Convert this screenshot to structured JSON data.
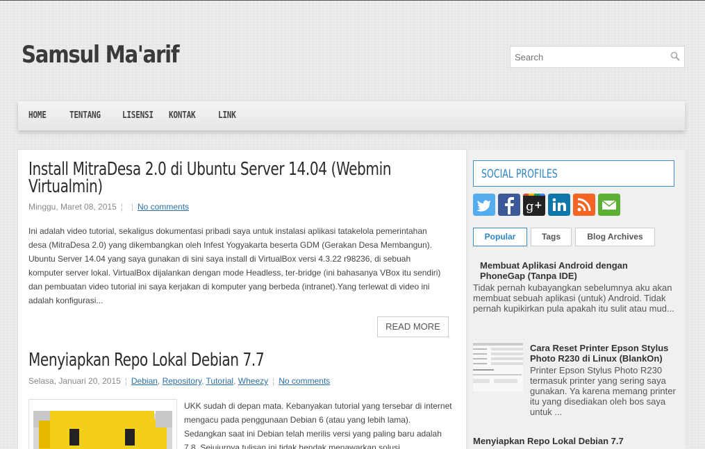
{
  "header": {
    "site_title": "Samsul Ma'arif",
    "search_placeholder": "Search"
  },
  "nav": [
    "HOME",
    "TENTANG",
    "LISENSI",
    "KONTAK",
    "LINK"
  ],
  "posts": [
    {
      "title": "Install MitraDesa 2.0 di Ubuntu Server 14.04 (Webmin Virtualmin)",
      "date": "Minggu, Maret 08, 2015",
      "comments": "No comments",
      "excerpt": "Ini adalah video tutorial, sekaligus dokumentasi pribadi saya untuk instalasi aplikasi tatakelola pemerintahan desa (MitraDesa 2.0) yang dikembangkan oleh Infest Yogyakarta beserta GDM (Gerakan Desa Membangun). Ubuntu Server 14.04 yang saya gunakan di sini saya install di VirtualBox versi 4.3.22 r98236, di sebuah komputer server lokal. VirtualBox dijalankan dengan mode Headless, ter-bridge (ini bahasanya VBox itu sendiri) dan pembuatan video tutorial ini saya kerjakan di komputer yang berbeda (intranet).Yang terlewat di video ini adalah konfigurasi...",
      "read_more": "READ MORE"
    },
    {
      "title": "Menyiapkan Repo Lokal Debian 7.7",
      "date": "Selasa, Januari 20, 2015",
      "labels": [
        "Debian",
        "Repository",
        "Tutorial",
        "Wheezy"
      ],
      "comments": "No comments",
      "excerpt": "UKK sudah di depan mata. Kebanyakan tutorial yang tersebar di internet mengacu pada penggunaan Debian 6 (atau yang lebih lama). Sedangkan saat ini Debian telah merilis versi yang paling baru adalah 7.8. Sejujurnya tulisan ini tidak hendak menawarkan solusi"
    }
  ],
  "sidebar": {
    "social_title": "SOCIAL PROFILES",
    "social_icons": [
      "twitter-icon",
      "facebook-icon",
      "google-plus-icon",
      "linkedin-icon",
      "rss-icon",
      "email-icon"
    ],
    "tabs": [
      "Popular",
      "Tags",
      "Blog Archives"
    ],
    "popular": [
      {
        "title": "Membuat Aplikasi Android dengan PhoneGap (Tanpa IDE)",
        "snippet": "Tidak pernah kubayangkan sebelumnya aku akan membuat sebuah aplikasi (untuk) Android. Tidak pernah kupikirkan pula apakah itu sulit atau mud..."
      },
      {
        "title": "Cara Reset Printer Epson Stylus Photo R230 di Linux (BlankOn)",
        "snippet": "Printer Epson Stylus Photo R230 termasuk printer yang sering saya gunakan. Ya karena memang printer itu yang disediakan oleh bos saya untuk ..."
      },
      {
        "title": "Menyiapkan Repo Lokal Debian 7.7",
        "snippet": ""
      }
    ]
  },
  "colors": {
    "accent": "#2e84c4",
    "link": "#2a6fa8",
    "twitter": "#55acee",
    "facebook": "#3b5998",
    "google": "#222222",
    "linkedin": "#0e76a8",
    "rss": "#f26522",
    "email": "#5cb135"
  }
}
